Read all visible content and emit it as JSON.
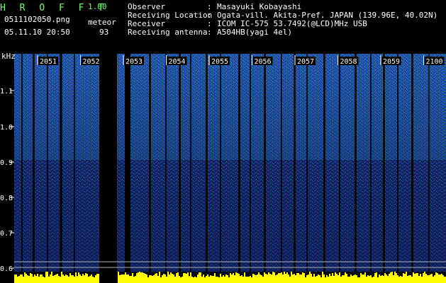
{
  "header": {
    "app_title": "H R O F F T",
    "version": "1.00",
    "file_name": "0511102050.png",
    "mode_label": "meteor",
    "date_time": "05.11.10 20:50",
    "count": "93"
  },
  "info": {
    "rows": [
      {
        "label": "Observer",
        "value": "Masayuki Kobayashi"
      },
      {
        "label": "Receiving Location",
        "value": "Ogata-vill. Akita-Pref. JAPAN (139.96E, 40.02N)"
      },
      {
        "label": "Receiver",
        "value": "ICOM IC-575 53.7492(@LCD)MHz USB"
      },
      {
        "label": "Receiving antenna",
        "value": "A504HB(yagi 4el)"
      }
    ],
    "separator": ":"
  },
  "axes": {
    "y_title": "kHz",
    "y_ticks": [
      "1.1",
      "1.0",
      "0.9",
      "0.8",
      "0.7",
      "0.6"
    ],
    "x_ticks": [
      "2051",
      "2052",
      "2053",
      "2054",
      "2055",
      "2056",
      "2057",
      "2058",
      "2059",
      "2100"
    ]
  },
  "colors": {
    "text_green": "#6cff6c",
    "text_white": "#ffffff",
    "level_yellow": "#ffff00",
    "spectrum_dark": "#1a2a7a",
    "spectrum_mid": "#1e6fd0",
    "spectrum_high": "#2fd0b0"
  }
}
